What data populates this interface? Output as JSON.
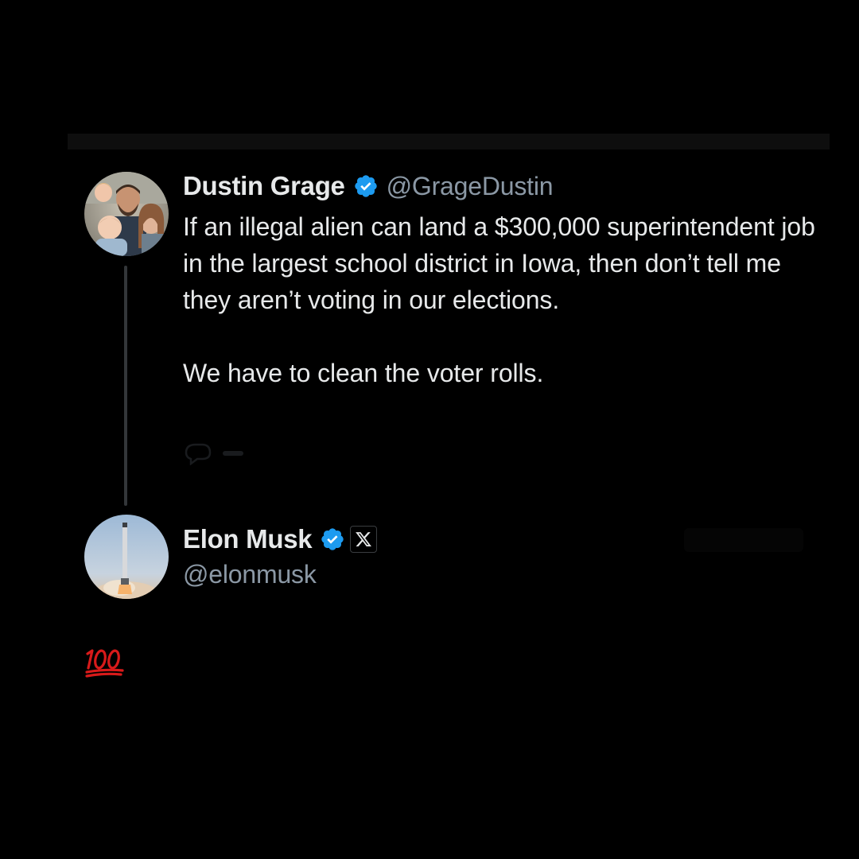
{
  "parent_tweet": {
    "author_name": "Dustin Grage",
    "author_handle": "@GrageDustin",
    "verified": true,
    "text_paragraph_1": "If an illegal alien can land a $300,000 superintendent job in the largest school district in Iowa, then don’t tell me they aren’t voting in our elections.",
    "text_paragraph_2": "We have to clean the voter rolls."
  },
  "reply_tweet": {
    "author_name": "Elon Musk",
    "author_handle": "@elonmusk",
    "verified": true,
    "affiliate_badge_icon": "x-logo-icon",
    "reply_emoji_icon": "hundred-points-icon"
  },
  "colors": {
    "background": "#000000",
    "text_primary": "#e7e9ea",
    "text_secondary": "#8b98a5",
    "verified_blue": "#1d9bf0",
    "thread_line": "#333639",
    "hundred_red": "#d81a1a"
  }
}
